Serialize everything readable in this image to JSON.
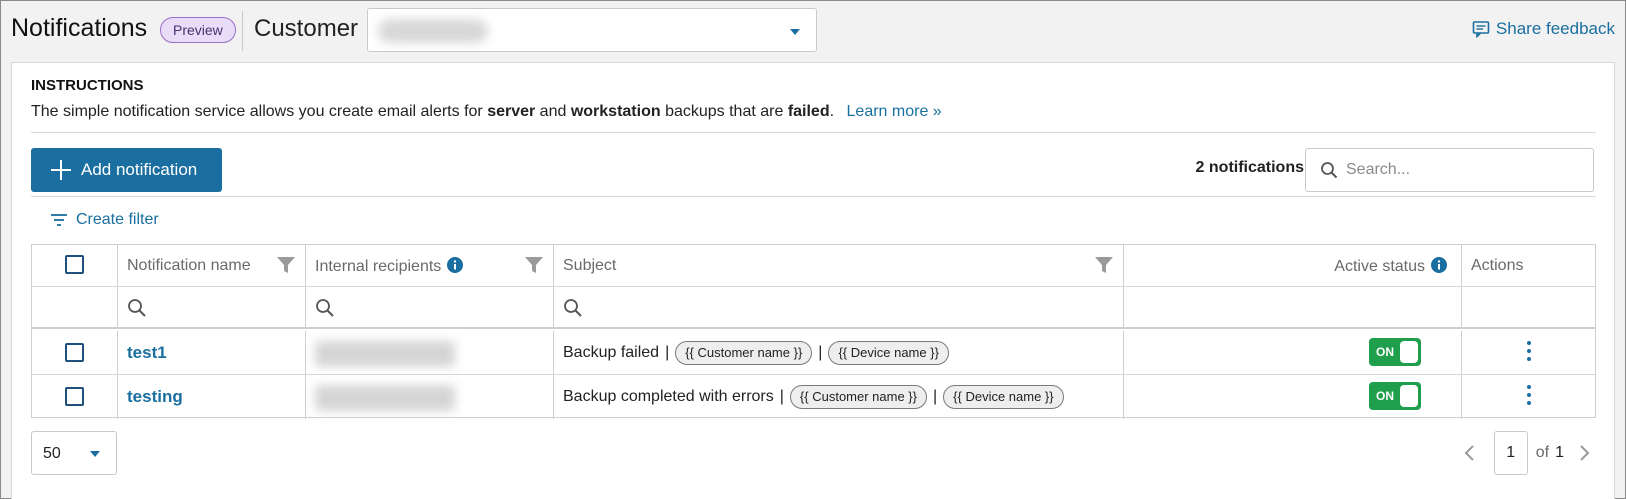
{
  "header": {
    "title": "Notifications",
    "badge": "Preview",
    "customer_label": "Customer",
    "share_feedback": "Share feedback"
  },
  "instructions": {
    "title": "INSTRUCTIONS",
    "text_1": "The simple notification service allows you create email alerts for ",
    "bold_1": "server",
    "text_2": " and ",
    "bold_2": "workstation",
    "text_3": " backups that are ",
    "bold_3": "failed",
    "text_4": ".",
    "learn_more": "Learn more »"
  },
  "toolbar": {
    "add_label": "Add notification",
    "count": "2 notifications",
    "search_placeholder": "Search...",
    "create_filter": "Create filter"
  },
  "table": {
    "columns": [
      "Notification name",
      "Internal recipients",
      "Subject",
      "Active status",
      "Actions"
    ],
    "rows": [
      {
        "name": "test1",
        "subject": "Backup failed",
        "tokens": [
          "{{ Customer name }}",
          "{{ Device name }}"
        ],
        "status": "ON"
      },
      {
        "name": "testing",
        "subject": "Backup completed with errors",
        "tokens": [
          "{{ Customer name }}",
          "{{ Device name }}"
        ],
        "status": "ON"
      }
    ]
  },
  "pagination": {
    "page_size": "50",
    "current_page": "1",
    "of_label": "of",
    "total_pages": "1"
  },
  "colors": {
    "accent": "#1a6fa0",
    "toggle_on": "#1f9e4c",
    "badge_bg": "#e9dcf8"
  }
}
